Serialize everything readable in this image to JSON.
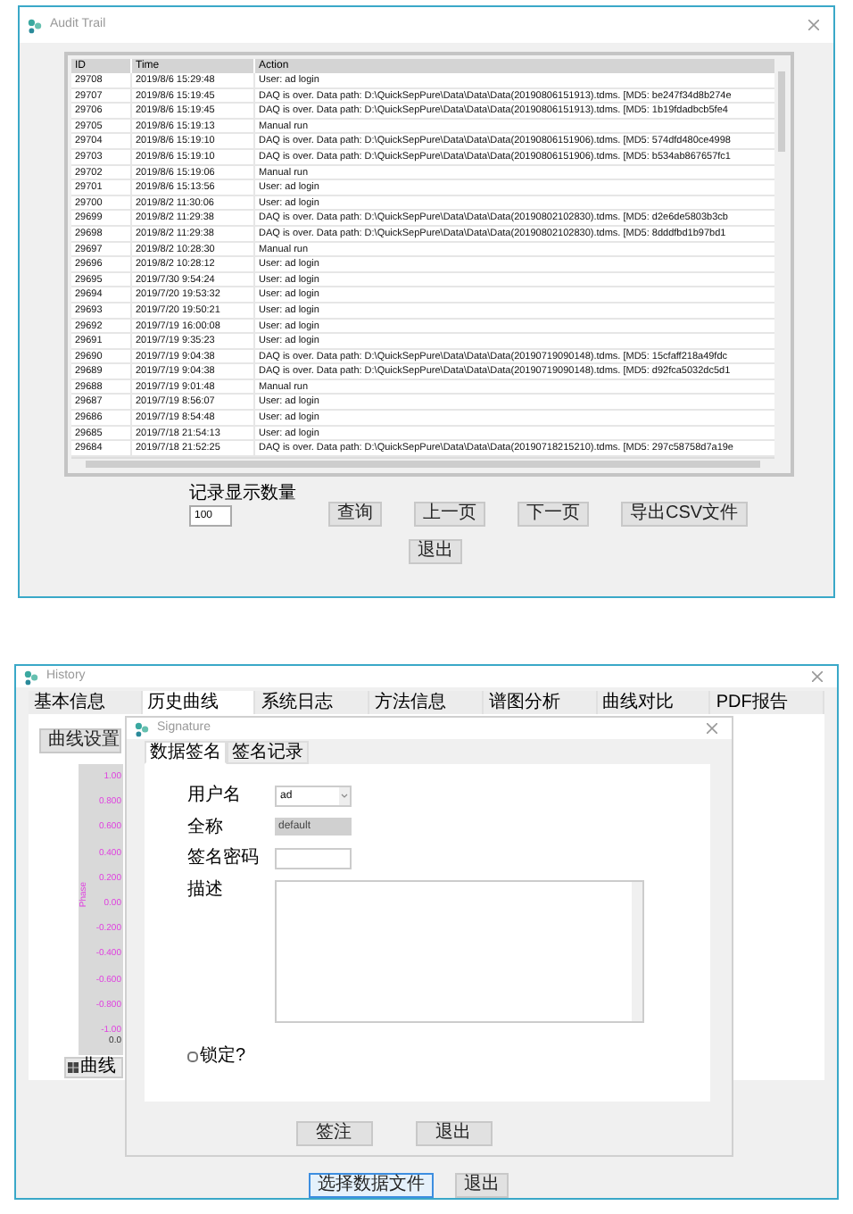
{
  "audit_window": {
    "title": "Audit Trail",
    "columns": [
      "ID",
      "Time",
      "Action"
    ],
    "rows": [
      {
        "id": "29708",
        "time": "2019/8/6 15:29:48",
        "action": "User: ad login"
      },
      {
        "id": "29707",
        "time": "2019/8/6 15:19:45",
        "action": "DAQ is over. Data path: D:\\QuickSepPure\\Data\\Data\\Data(20190806151913).tdms. [MD5: be247f34d8b274e"
      },
      {
        "id": "29706",
        "time": "2019/8/6 15:19:45",
        "action": "DAQ is over. Data path: D:\\QuickSepPure\\Data\\Data\\Data(20190806151913).tdms. [MD5: 1b19fdadbcb5fe4"
      },
      {
        "id": "29705",
        "time": "2019/8/6 15:19:13",
        "action": "Manual run"
      },
      {
        "id": "29704",
        "time": "2019/8/6 15:19:10",
        "action": "DAQ is over. Data path: D:\\QuickSepPure\\Data\\Data\\Data(20190806151906).tdms. [MD5: 574dfd480ce4998"
      },
      {
        "id": "29703",
        "time": "2019/8/6 15:19:10",
        "action": "DAQ is over. Data path: D:\\QuickSepPure\\Data\\Data\\Data(20190806151906).tdms. [MD5: b534ab867657fc1"
      },
      {
        "id": "29702",
        "time": "2019/8/6 15:19:06",
        "action": "Manual run"
      },
      {
        "id": "29701",
        "time": "2019/8/6 15:13:56",
        "action": "User: ad login"
      },
      {
        "id": "29700",
        "time": "2019/8/2 11:30:06",
        "action": "User: ad login"
      },
      {
        "id": "29699",
        "time": "2019/8/2 11:29:38",
        "action": "DAQ is over. Data path: D:\\QuickSepPure\\Data\\Data\\Data(20190802102830).tdms. [MD5: d2e6de5803b3cb"
      },
      {
        "id": "29698",
        "time": "2019/8/2 11:29:38",
        "action": "DAQ is over. Data path: D:\\QuickSepPure\\Data\\Data\\Data(20190802102830).tdms. [MD5: 8dddfbd1b97bd1"
      },
      {
        "id": "29697",
        "time": "2019/8/2 10:28:30",
        "action": "Manual run"
      },
      {
        "id": "29696",
        "time": "2019/8/2 10:28:12",
        "action": "User: ad login"
      },
      {
        "id": "29695",
        "time": "2019/7/30 9:54:24",
        "action": "User: ad login"
      },
      {
        "id": "29694",
        "time": "2019/7/20 19:53:32",
        "action": "User: ad login"
      },
      {
        "id": "29693",
        "time": "2019/7/20 19:50:21",
        "action": "User: ad login"
      },
      {
        "id": "29692",
        "time": "2019/7/19 16:00:08",
        "action": "User: ad login"
      },
      {
        "id": "29691",
        "time": "2019/7/19 9:35:23",
        "action": "User: ad login"
      },
      {
        "id": "29690",
        "time": "2019/7/19 9:04:38",
        "action": "DAQ is over. Data path: D:\\QuickSepPure\\Data\\Data\\Data(20190719090148).tdms. [MD5: 15cfaff218a49fdc"
      },
      {
        "id": "29689",
        "time": "2019/7/19 9:04:38",
        "action": "DAQ is over. Data path: D:\\QuickSepPure\\Data\\Data\\Data(20190719090148).tdms. [MD5: d92fca5032dc5d1"
      },
      {
        "id": "29688",
        "time": "2019/7/19 9:01:48",
        "action": "Manual run"
      },
      {
        "id": "29687",
        "time": "2019/7/19 8:56:07",
        "action": "User: ad login"
      },
      {
        "id": "29686",
        "time": "2019/7/19 8:54:48",
        "action": "User: ad login"
      },
      {
        "id": "29685",
        "time": "2019/7/18 21:54:13",
        "action": "User: ad login"
      },
      {
        "id": "29684",
        "time": "2019/7/18 21:52:25",
        "action": "DAQ is over. Data path: D:\\QuickSepPure\\Data\\Data\\Data(20190718215210).tdms. [MD5: 297c58758d7a19e"
      }
    ],
    "record_count_label": "记录显示数量",
    "record_count": "100",
    "buttons": [
      "查询",
      "上一页",
      "下一页",
      "导出CSV文件"
    ],
    "exit_button": "退出"
  },
  "history_window": {
    "title": "History",
    "tabs": [
      {
        "label": "基本信息",
        "selected": false
      },
      {
        "label": "历史曲线",
        "selected": true
      },
      {
        "label": "系统日志",
        "selected": false
      },
      {
        "label": "方法信息",
        "selected": false
      },
      {
        "label": "谱图分析",
        "selected": false
      },
      {
        "label": "曲线对比",
        "selected": false
      },
      {
        "label": "PDF报告",
        "selected": false
      }
    ],
    "curve_settings_button": "曲线设置",
    "chart": {
      "ylabel": "Phase",
      "yticks": [
        "1.00",
        "0.800",
        "0.600",
        "0.400",
        "0.200",
        "0.00",
        "-0.200",
        "-0.400",
        "-0.600",
        "-0.800",
        "-1.00"
      ],
      "xtick": "0.0"
    },
    "legend": "曲线",
    "buttons": [
      {
        "label": "选择数据文件",
        "focused": true
      },
      {
        "label": "退出",
        "focused": false
      }
    ]
  },
  "signature_dialog": {
    "title": "Signature",
    "tabs": [
      {
        "label": "数据签名",
        "selected": true
      },
      {
        "label": "签名记录",
        "selected": false
      }
    ],
    "fields": [
      {
        "kind": "combo",
        "label": "用户名",
        "value": "ad"
      },
      {
        "kind": "readonly",
        "label": "全称",
        "value": "default"
      },
      {
        "kind": "password",
        "label": "签名密码"
      },
      {
        "kind": "textarea",
        "label": "描述"
      }
    ],
    "lock_checkbox": {
      "label": "锁定?",
      "checked": false
    },
    "buttons": [
      "签注",
      "退出"
    ]
  }
}
